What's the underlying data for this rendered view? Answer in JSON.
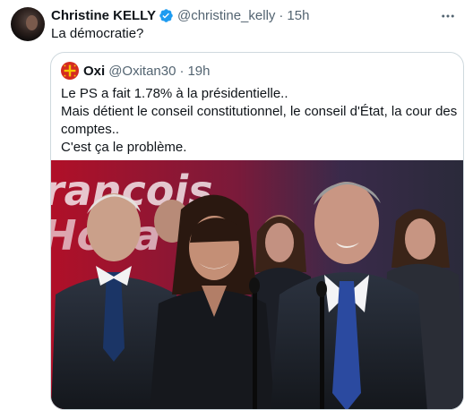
{
  "tweet": {
    "author_name": "Christine KELLY",
    "author_handle": "@christine_kelly",
    "separator": "·",
    "time": "15h",
    "text": "La démocratie?",
    "verified": true
  },
  "quote": {
    "author_name": "Oxi",
    "author_handle": "@Oxitan30",
    "separator": "·",
    "time": "19h",
    "lines": [
      "Le PS a fait 1.78% à la présidentielle..",
      "Mais détient le conseil constitutionnel, le conseil d'État, la cour des",
      "comptes..",
      "C'est ça le problème."
    ],
    "photo_backdrop_text": [
      "rançois",
      "Holla"
    ]
  },
  "colors": {
    "verified_blue": "#1d9bf0",
    "secondary_text": "#536471",
    "border": "#cfd9de",
    "backdrop_red": "#c8102e"
  },
  "icons": {
    "verified": "verified-badge-icon",
    "more": "more-icon",
    "quote_avatar": "occitan-cross-icon"
  }
}
